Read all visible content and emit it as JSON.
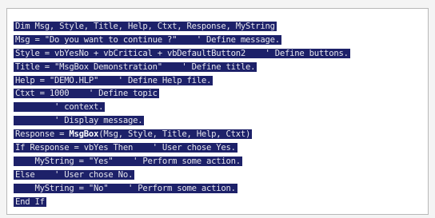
{
  "colors": {
    "selection_bg": "#1d2169",
    "selection_text": "#e6e6ee",
    "page_bg": "#ffffff"
  },
  "code_lines": [
    "Dim Msg, Style, Title, Help, Ctxt, Response, MyString",
    "Msg = \"Do you want to continue ?\"    ' Define message.",
    "Style = vbYesNo + vbCritical + vbDefaultButton2    ' Define buttons.",
    "Title = \"MsgBox Demonstration\"    ' Define title.",
    "Help = \"DEMO.HLP\"    ' Define Help file.",
    "Ctxt = 1000    ' Define topic",
    "        ' context.",
    "        ' Display message.",
    {
      "pre": "Response = ",
      "kw": "MsgBox",
      "post": "(Msg, Style, Title, Help, Ctxt)"
    },
    "If Response = vbYes Then    ' User chose Yes.",
    "    MyString = \"Yes\"    ' Perform some action.",
    "Else    ' User chose No.",
    "    MyString = \"No\"    ' Perform some action.",
    "End If"
  ]
}
